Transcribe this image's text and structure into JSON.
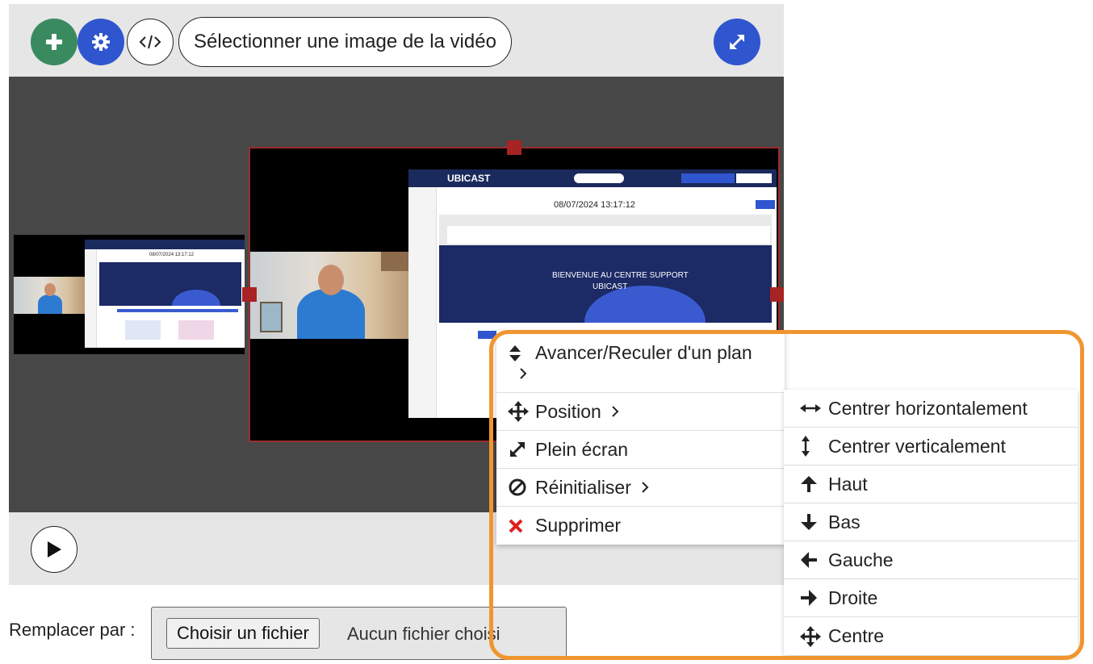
{
  "toolbar": {
    "add_icon": "plus-icon",
    "settings_icon": "gear-icon",
    "code_icon": "code-icon",
    "select_frame_label": "Sélectionner une image de la vidéo",
    "fullscreen_icon": "expand-icon"
  },
  "stage": {
    "web_title": "08/07/2024 13:17:12",
    "web_banner_line1": "BIENVENUE AU CENTRE SUPPORT",
    "web_banner_line2": "UBICAST",
    "web_brand": "UBICAST",
    "small_title": "08/07/2024 13:17:12"
  },
  "context_menu": {
    "items": [
      {
        "label": "Avancer/Reculer d'un plan",
        "icon": "sort-icon",
        "has_submenu": true
      },
      {
        "label": "Position",
        "icon": "move-icon",
        "has_submenu": true
      },
      {
        "label": "Plein écran",
        "icon": "expand-icon",
        "has_submenu": false
      },
      {
        "label": "Réinitialiser",
        "icon": "ban-icon",
        "has_submenu": true
      },
      {
        "label": "Supprimer",
        "icon": "close-icon",
        "has_submenu": false
      }
    ]
  },
  "position_submenu": {
    "items": [
      {
        "label": "Centrer horizontalement",
        "icon": "arrows-horizontal-icon"
      },
      {
        "label": "Centrer verticalement",
        "icon": "arrows-vertical-icon"
      },
      {
        "label": "Haut",
        "icon": "arrow-up-icon"
      },
      {
        "label": "Bas",
        "icon": "arrow-down-icon"
      },
      {
        "label": "Gauche",
        "icon": "arrow-left-icon"
      },
      {
        "label": "Droite",
        "icon": "arrow-right-icon"
      },
      {
        "label": "Centre",
        "icon": "move-icon"
      }
    ]
  },
  "replace": {
    "label": "Remplacer par :",
    "button_label": "Choisir un fichier",
    "status": "Aucun fichier choisi"
  },
  "colors": {
    "green": "#3a8a60",
    "blue": "#2f56cf",
    "highlight": "#f0962f",
    "selection": "#9b2d2d",
    "delete": "#e02020"
  }
}
